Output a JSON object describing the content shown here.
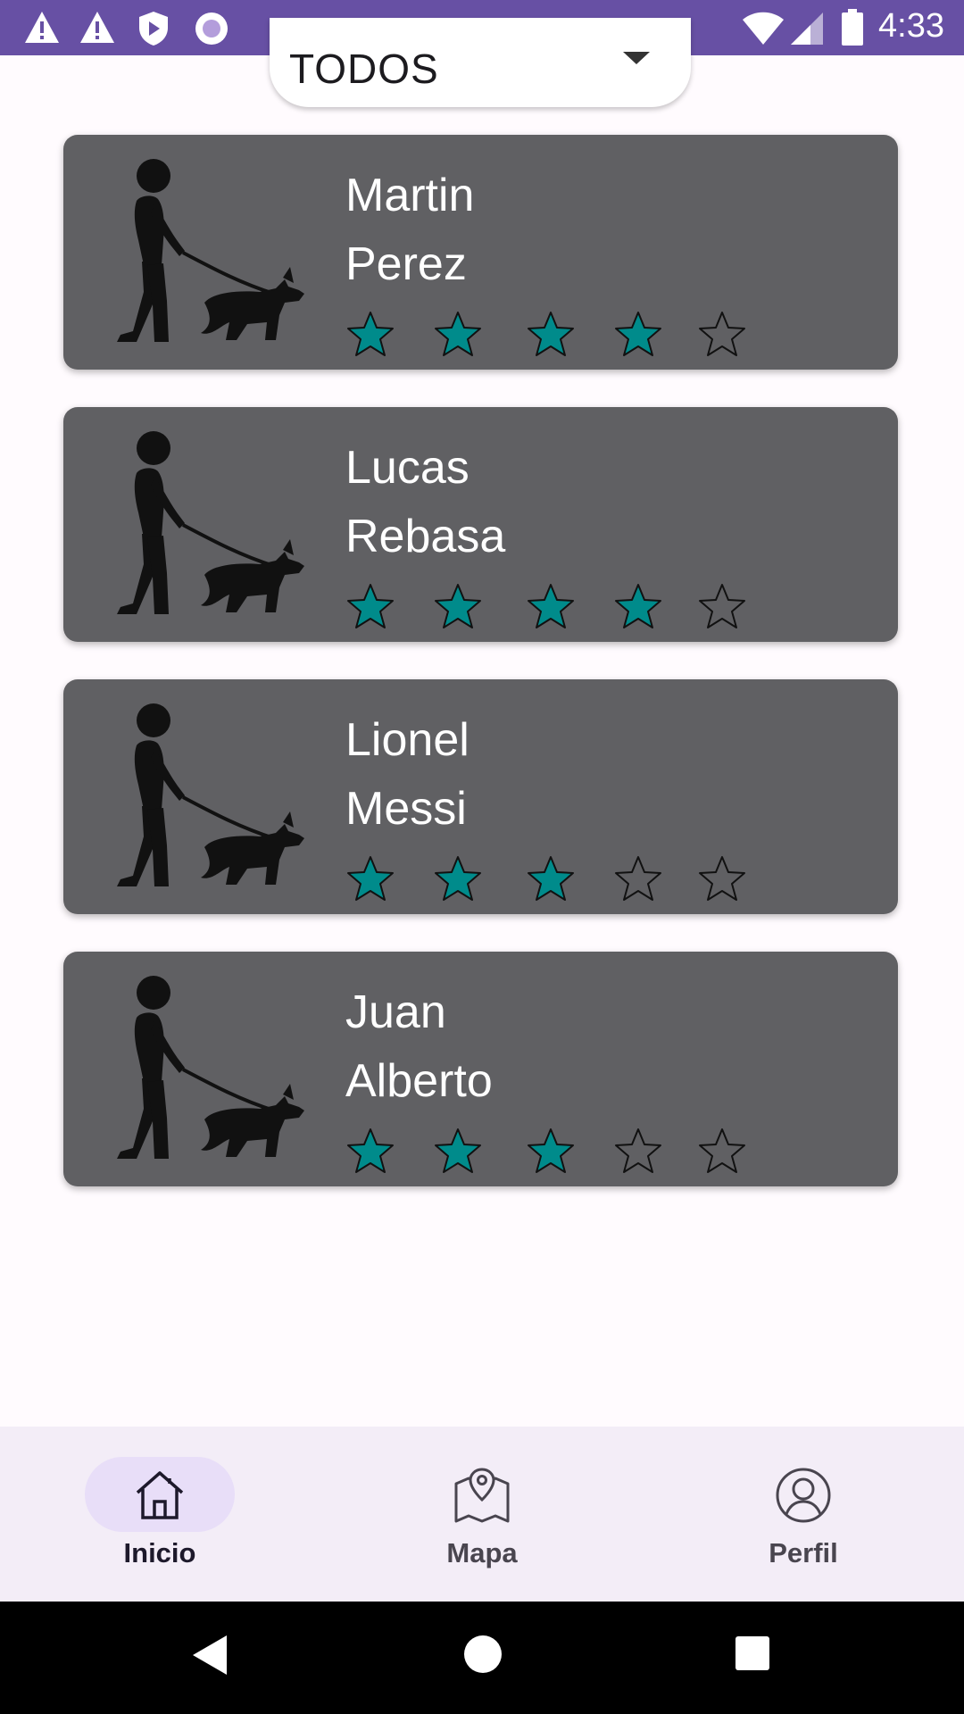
{
  "status_bar": {
    "time": "4:33",
    "left_icons": [
      "warning-icon",
      "warning-icon",
      "shield-play-icon",
      "radio-dot-icon"
    ],
    "right_icons": [
      "wifi-icon",
      "cell-signal-icon",
      "battery-icon"
    ],
    "background": "#6750a4"
  },
  "filter": {
    "value": "TODOS",
    "icon": "chevron-down-icon"
  },
  "walkers": [
    {
      "first_name": "Martin",
      "last_name": "Perez",
      "rating": 4,
      "max_rating": 5
    },
    {
      "first_name": "Lucas",
      "last_name": "Rebasa",
      "rating": 4,
      "max_rating": 5
    },
    {
      "first_name": "Lionel",
      "last_name": "Messi",
      "rating": 3,
      "max_rating": 5
    },
    {
      "first_name": "Juan",
      "last_name": "Alberto",
      "rating": 3,
      "max_rating": 5
    }
  ],
  "colors": {
    "card_background": "#606063",
    "star_filled": "#008b8b",
    "accent": "#6750a4",
    "nav_active_pill": "#e8def8"
  },
  "bottom_nav": {
    "items": [
      {
        "label": "Inicio",
        "icon": "home-icon",
        "active": true
      },
      {
        "label": "Mapa",
        "icon": "map-icon",
        "active": false
      },
      {
        "label": "Perfil",
        "icon": "profile-icon",
        "active": false
      }
    ]
  },
  "system_nav": [
    "back-icon",
    "home-circle-icon",
    "recents-icon"
  ]
}
